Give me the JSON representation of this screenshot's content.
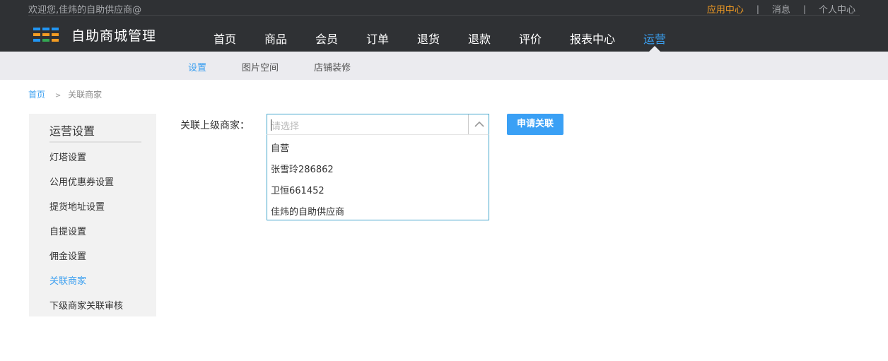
{
  "header": {
    "welcome": "欢迎您,佳炜的自助供应商@",
    "links": [
      {
        "label": "应用中心",
        "active": true
      },
      {
        "label": "消息"
      },
      {
        "label": "个人中心"
      }
    ],
    "separator": "|",
    "app_title": "自助商城管理",
    "nav": [
      {
        "label": "首页"
      },
      {
        "label": "商品"
      },
      {
        "label": "会员"
      },
      {
        "label": "订单"
      },
      {
        "label": "退货"
      },
      {
        "label": "退款"
      },
      {
        "label": "评价"
      },
      {
        "label": "报表中心"
      },
      {
        "label": "运营",
        "active": true
      }
    ]
  },
  "subnav": [
    {
      "label": "设置",
      "active": true
    },
    {
      "label": "图片空间"
    },
    {
      "label": "店铺装修"
    }
  ],
  "breadcrumb": {
    "home": "首页",
    "arrow": ">",
    "current": "关联商家"
  },
  "sidebar": {
    "title": "运营设置",
    "items": [
      {
        "label": "灯塔设置"
      },
      {
        "label": "公用优惠券设置"
      },
      {
        "label": "提货地址设置"
      },
      {
        "label": "自提设置"
      },
      {
        "label": "佣金设置"
      },
      {
        "label": "关联商家",
        "active": true
      },
      {
        "label": "下级商家关联审核"
      }
    ]
  },
  "form": {
    "label": "关联上级商家：",
    "select_placeholder": "请选择",
    "options": [
      "自营",
      "张雪玲286862",
      "卫恒661452",
      "佳炜的自助供应商"
    ],
    "apply_button": "申请关联"
  },
  "colors": {
    "accent": "#3a9ff0",
    "highlight": "#f39c23",
    "header_bg": "#2f3134"
  },
  "icons": {
    "logo": "grid-logo-icon",
    "select_toggle": "chevron-up-icon"
  }
}
